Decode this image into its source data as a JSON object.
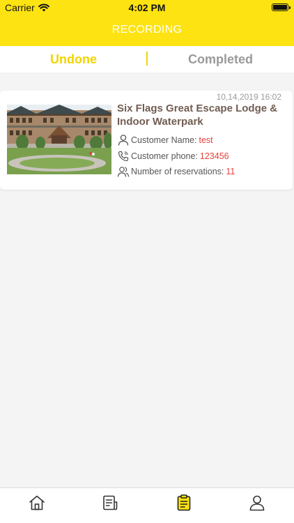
{
  "status_bar": {
    "carrier": "Carrier",
    "time": "4:02 PM"
  },
  "header": {
    "title": "RECORDING"
  },
  "tabs": [
    {
      "label": "Undone",
      "active": true
    },
    {
      "label": "Completed",
      "active": false
    }
  ],
  "records": [
    {
      "date": "10,14,2019 16:02",
      "title": "Six Flags Great Escape Lodge & Indoor Waterpark",
      "customer_name_label": "Customer Name:",
      "customer_name": "test",
      "customer_phone_label": "Customer phone:",
      "customer_phone": "123456",
      "reservations_label": "Number of reservations:",
      "reservations": "11"
    }
  ],
  "tabbar": {
    "items": [
      {
        "icon": "home-icon",
        "active": false
      },
      {
        "icon": "orders-icon",
        "active": false
      },
      {
        "icon": "records-icon",
        "active": true
      },
      {
        "icon": "profile-icon",
        "active": false
      }
    ]
  },
  "colors": {
    "accent": "#fde311",
    "tab_active": "#f3d400",
    "tab_inactive": "#9a9a9a",
    "title_text": "#715d52",
    "value_red": "#e8413c",
    "background": "#f4f4f4"
  }
}
